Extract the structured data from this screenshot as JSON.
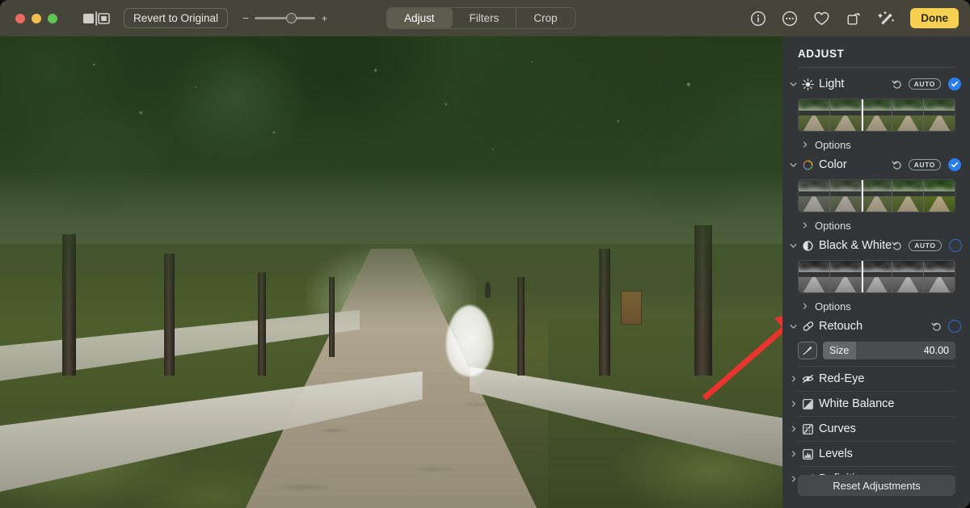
{
  "window": {
    "traffic_lights": [
      "close",
      "minimize",
      "maximize"
    ],
    "compare_toggle_icon": "split-view-icon",
    "revert_label": "Revert to Original",
    "zoom": {
      "minus": "−",
      "plus": "+",
      "position_percent": 60
    }
  },
  "mode_tabs": [
    {
      "label": "Adjust",
      "active": true
    },
    {
      "label": "Filters",
      "active": false
    },
    {
      "label": "Crop",
      "active": false
    }
  ],
  "toolbar_right": {
    "icons": [
      "info-icon",
      "more-options-icon",
      "favorite-heart-icon",
      "rotate-icon",
      "auto-enhance-wand-icon"
    ],
    "done_label": "Done",
    "done_color": "#f7cf51"
  },
  "sidebar": {
    "title": "ADJUST",
    "accent_blue": "#2a7df0",
    "auto_label": "AUTO",
    "options_label": "Options",
    "reset_label": "Reset Adjustments",
    "sections": [
      {
        "label": "Light",
        "icon": "sun-icon",
        "expanded": true,
        "has_auto": true,
        "enabled": true,
        "has_strip": true,
        "strip_grayscale": false,
        "strip_marker_percent": 60,
        "has_options": true
      },
      {
        "label": "Color",
        "icon": "color-wheel-icon",
        "expanded": true,
        "has_auto": true,
        "enabled": true,
        "has_strip": true,
        "strip_grayscale": false,
        "strip_marker_percent": 60,
        "has_options": true
      },
      {
        "label": "Black & White",
        "icon": "contrast-circle-icon",
        "expanded": true,
        "has_auto": true,
        "enabled": false,
        "has_strip": true,
        "strip_grayscale": true,
        "strip_marker_percent": 50,
        "has_options": true
      }
    ],
    "retouch": {
      "label": "Retouch",
      "icon": "bandage-icon",
      "expanded": true,
      "has_auto": false,
      "enabled": false,
      "brush_tool_icon": "retouch-brush-icon",
      "size_label": "Size",
      "size_value": "40.00",
      "size_fill_percent": 25
    },
    "collapsed_sections": [
      {
        "label": "Red-Eye",
        "icon": "eye-slash-icon"
      },
      {
        "label": "White Balance",
        "icon": "white-balance-icon"
      },
      {
        "label": "Curves",
        "icon": "curves-icon"
      },
      {
        "label": "Levels",
        "icon": "levels-icon"
      },
      {
        "label": "Definition",
        "icon": "definition-icon"
      }
    ]
  },
  "canvas": {
    "photo_description": "tree-lined walking path",
    "retouch_overlay": "retouch-brush-mask",
    "annotation_arrow": {
      "color": "#e8332f",
      "points_to": "retouch-brush-tool-button"
    }
  }
}
